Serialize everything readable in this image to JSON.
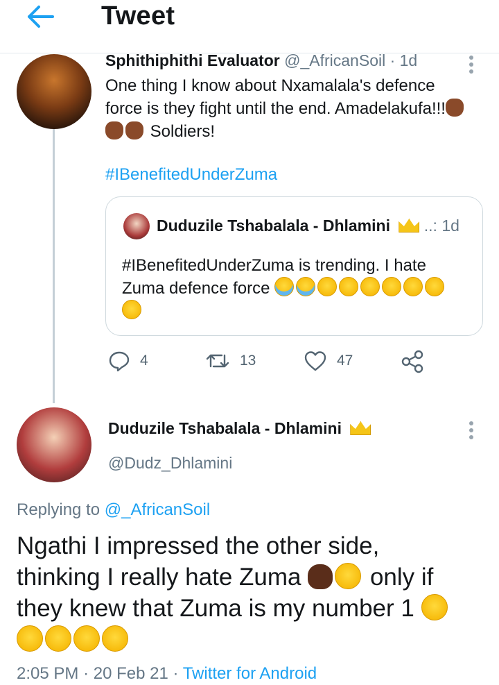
{
  "header": {
    "title": "Tweet"
  },
  "tweet1": {
    "author_name": "Sphithiphithi Evaluator",
    "author_handle": "@_AfricanSoil",
    "time": "· 1d",
    "text_line1": "One thing I know about Nxamalala's defence",
    "text_line2": "force is they fight until the end. Amadelakufa!!!",
    "text_line3": "Soldiers!",
    "hashtag": "#IBenefitedUnderZuma",
    "quoted": {
      "author_name": "Duduzile Tshabalala - Dhlamini",
      "extra": "..:",
      "time": "1d",
      "text_line1": "#IBenefitedUnderZuma is trending. I hate",
      "text_line2": "Zuma defence force"
    },
    "actions": {
      "replies": "4",
      "retweets": "13",
      "likes": "47"
    }
  },
  "tweet2": {
    "author_name": "Duduzile Tshabalala - Dhlamini",
    "author_handle": "@Dudz_Dhlamini",
    "replying_prefix": "Replying to",
    "replying_to": "@_AfricanSoil",
    "text_line1": "Ngathi I impressed the other side,",
    "text_line2": "thinking I really hate Zuma",
    "text_line2b": "only if",
    "text_line3": "they knew that Zuma is my number 1",
    "time": "2:05 PM",
    "date": "· 20 Feb 21 ·",
    "source": "Twitter for Android"
  },
  "colors": {
    "accent": "#1da1f2",
    "muted": "#657786",
    "border": "#cfd9de"
  },
  "icons": [
    "back-arrow-icon",
    "more-dots-icon",
    "reply-icon",
    "retweet-icon",
    "like-icon",
    "share-icon",
    "crown-emoji",
    "fist-emoji",
    "laugh-emoji",
    "cry-emoji",
    "facepalm-emoji"
  ]
}
